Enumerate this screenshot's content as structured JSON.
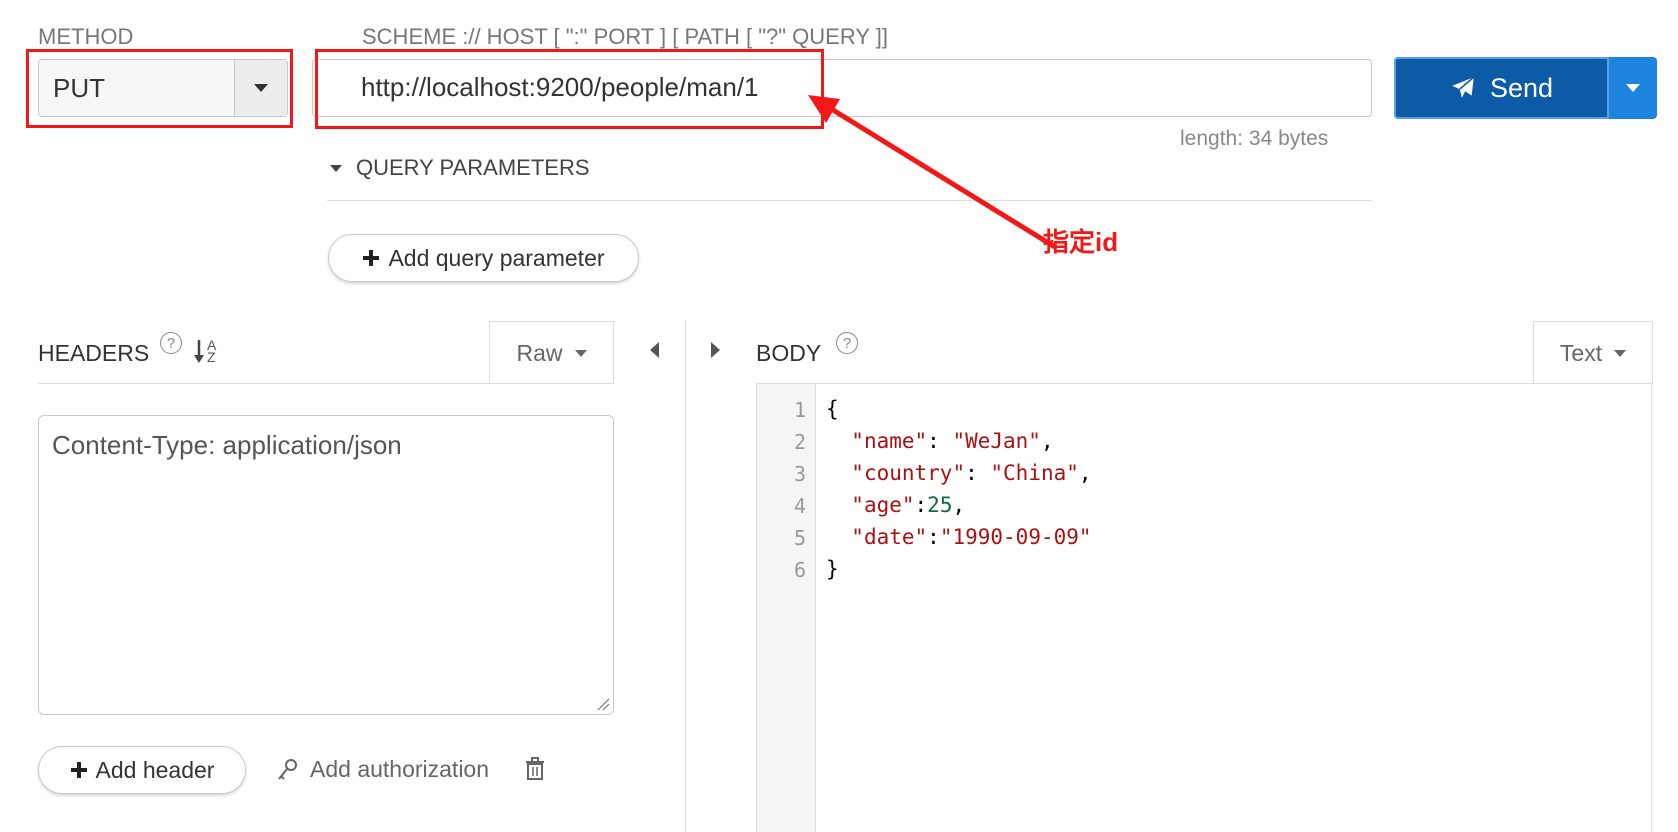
{
  "request": {
    "method_label": "METHOD",
    "method_value": "PUT",
    "url_label": "SCHEME :// HOST [ \":\" PORT ] [ PATH [ \"?\" QUERY ]]",
    "url_value": "http://localhost:9200/people/man/1",
    "length_text": "length: 34 bytes",
    "send_label": "Send"
  },
  "query": {
    "toggle_label": "QUERY PARAMETERS",
    "add_label": "Add query parameter"
  },
  "annotation": {
    "text": "指定id",
    "color": "#f21818"
  },
  "headers": {
    "title": "HEADERS",
    "help": "?",
    "sort_top": "A",
    "sort_bottom": "Z",
    "mode": "Raw",
    "content": "Content-Type: application/json",
    "add_header_label": "Add header",
    "add_auth_label": "Add authorization"
  },
  "body": {
    "title": "BODY",
    "help": "?",
    "mode": "Text",
    "line_numbers": [
      "1",
      "2",
      "3",
      "4",
      "5",
      "6"
    ],
    "lines": {
      "l1": "{",
      "l2_key": "\"name\"",
      "l2_sep": ": ",
      "l2_val": "\"WeJan\"",
      "l2_end": ",",
      "l3_key": "\"country\"",
      "l3_sep": ": ",
      "l3_val": "\"China\"",
      "l3_end": ",",
      "l4_key": "\"age\"",
      "l4_sep": ":",
      "l4_val": "25",
      "l4_end": ",",
      "l5_key": "\"date\"",
      "l5_sep": ":",
      "l5_val": "\"1990-09-09\"",
      "l6": "}"
    }
  },
  "colors": {
    "send_bg": "#0d5aa7",
    "send_caret_bg": "#1f84e0",
    "json_string": "#aa1111",
    "json_number": "#116644"
  }
}
